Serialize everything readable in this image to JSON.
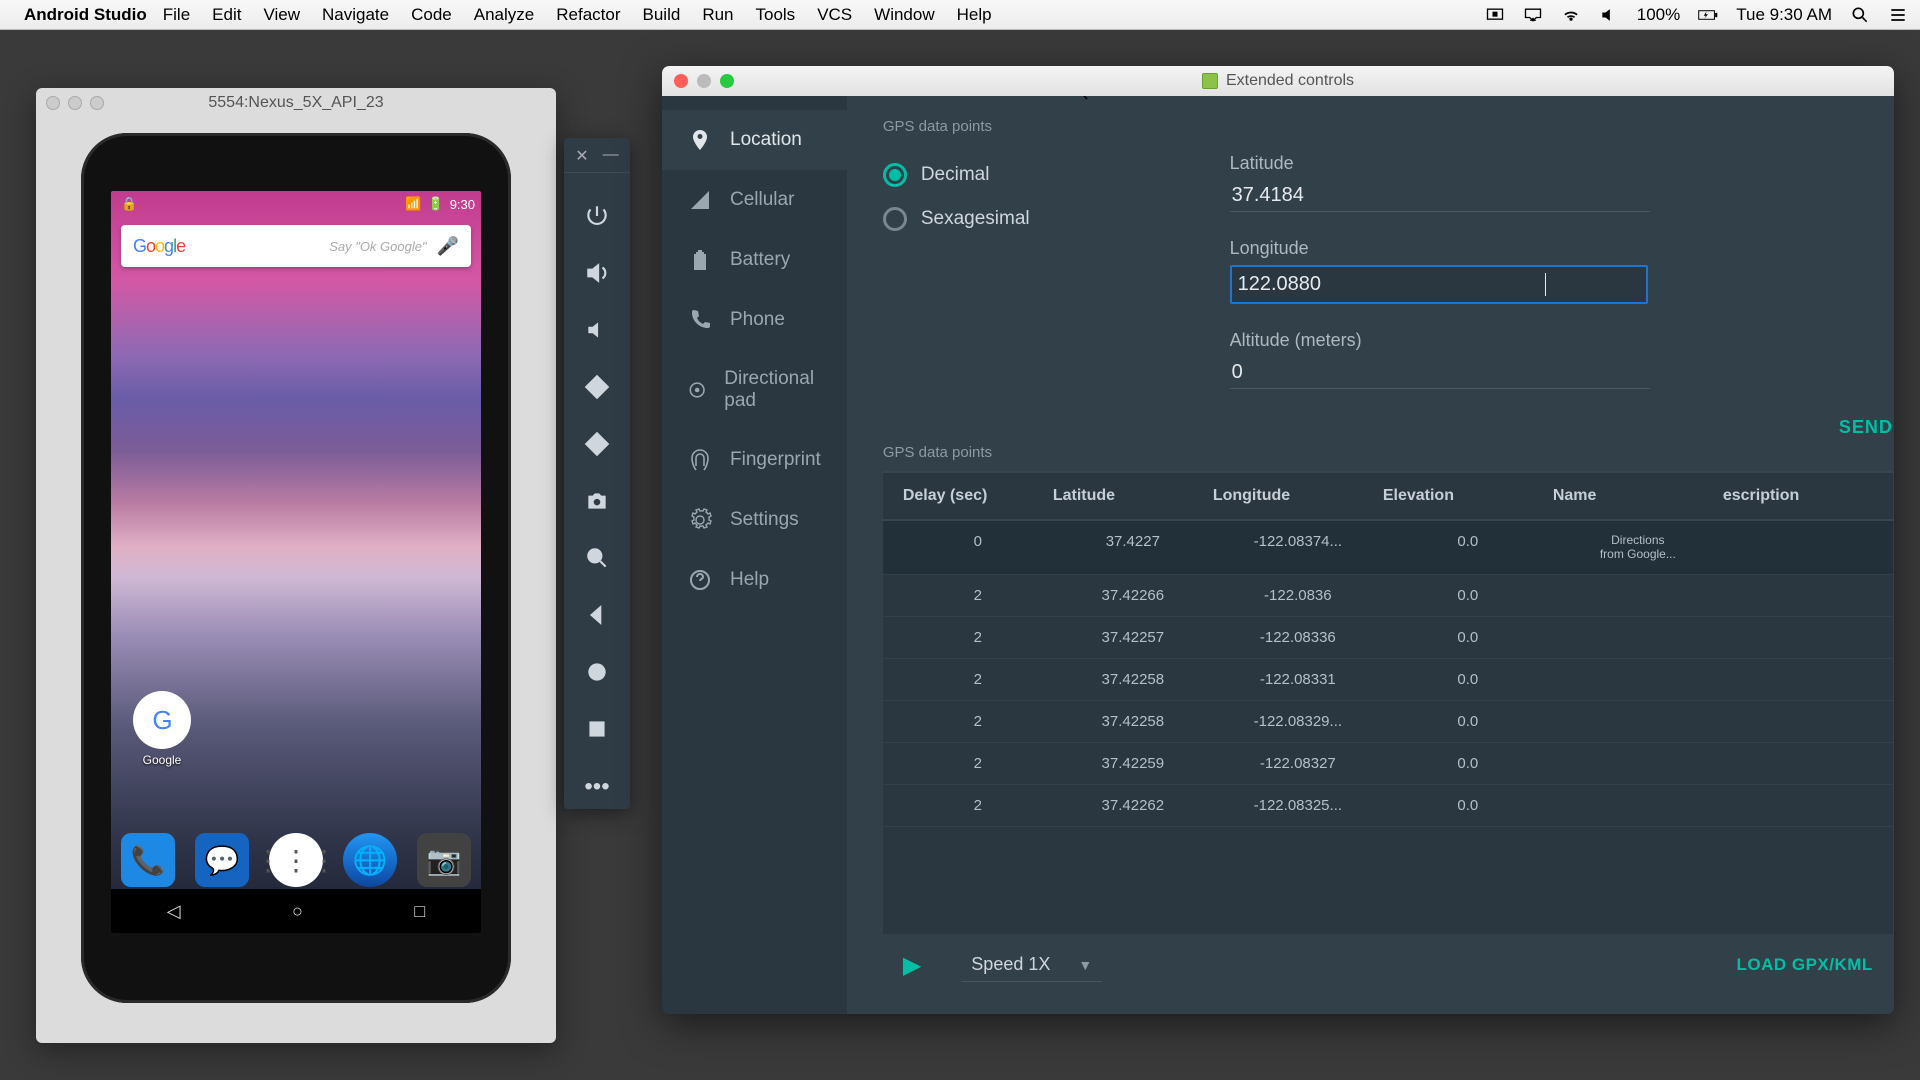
{
  "menubar": {
    "app": "Android Studio",
    "items": [
      "File",
      "Edit",
      "View",
      "Navigate",
      "Code",
      "Analyze",
      "Refactor",
      "Build",
      "Run",
      "Tools",
      "VCS",
      "Window",
      "Help"
    ],
    "battery": "100%",
    "clock": "Tue 9:30 AM"
  },
  "emulator": {
    "title": "5554:Nexus_5X_API_23",
    "status_time": "9:30",
    "search_hint": "Say \"Ok Google\"",
    "google_label": "Google"
  },
  "ext": {
    "title": "Extended controls",
    "sidebar": [
      "Location",
      "Cellular",
      "Battery",
      "Phone",
      "Directional pad",
      "Fingerprint",
      "Settings",
      "Help"
    ],
    "gps_section_label": "GPS data points",
    "format": {
      "decimal": "Decimal",
      "sexagesimal": "Sexagesimal"
    },
    "fields": {
      "lat_label": "Latitude",
      "lat_value": "37.4184",
      "lon_label": "Longitude",
      "lon_value": "122.0880",
      "alt_label": "Altitude (meters)",
      "alt_value": "0"
    },
    "send": "SEND",
    "table": {
      "headers": [
        "Delay (sec)",
        "Latitude",
        "Longitude",
        "Elevation",
        "Name",
        "escription"
      ],
      "rows": [
        {
          "delay": "0",
          "lat": "37.4227",
          "lon": "-122.08374...",
          "elev": "0.0",
          "name": "Directions from Google...",
          "desc": ""
        },
        {
          "delay": "2",
          "lat": "37.42266",
          "lon": "-122.0836",
          "elev": "0.0",
          "name": "",
          "desc": ""
        },
        {
          "delay": "2",
          "lat": "37.42257",
          "lon": "-122.08336",
          "elev": "0.0",
          "name": "",
          "desc": ""
        },
        {
          "delay": "2",
          "lat": "37.42258",
          "lon": "-122.08331",
          "elev": "0.0",
          "name": "",
          "desc": ""
        },
        {
          "delay": "2",
          "lat": "37.42258",
          "lon": "-122.08329...",
          "elev": "0.0",
          "name": "",
          "desc": ""
        },
        {
          "delay": "2",
          "lat": "37.42259",
          "lon": "-122.08327",
          "elev": "0.0",
          "name": "",
          "desc": ""
        },
        {
          "delay": "2",
          "lat": "37.42262",
          "lon": "-122.08325...",
          "elev": "0.0",
          "name": "",
          "desc": ""
        }
      ]
    },
    "speed": "Speed 1X",
    "load": "LOAD GPX/KML"
  }
}
